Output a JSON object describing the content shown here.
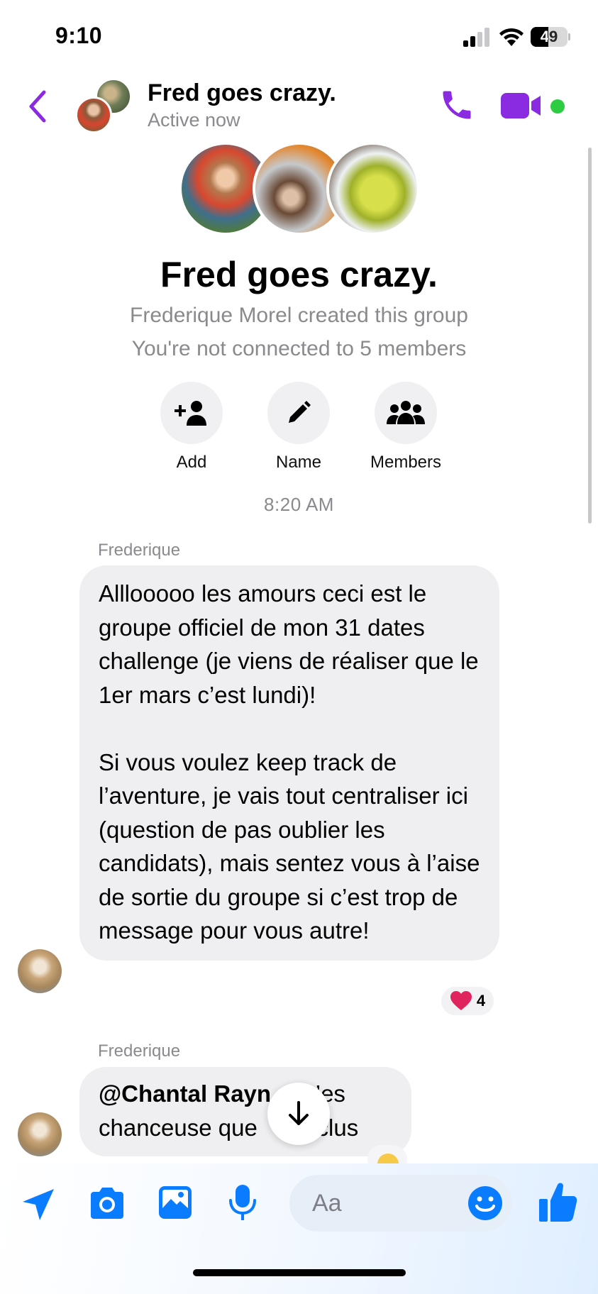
{
  "status_bar": {
    "time": "9:10",
    "battery": "49",
    "battery_level": 0.49
  },
  "header": {
    "title": "Fred goes crazy.",
    "subtitle": "Active now"
  },
  "group_intro": {
    "name": "Fred goes crazy.",
    "creator_line": "Frederique Morel created this group",
    "connection_line": "You're not connected to 5 members",
    "actions": [
      {
        "label": "Add",
        "icon": "add-person-icon"
      },
      {
        "label": "Name",
        "icon": "pencil-icon"
      },
      {
        "label": "Members",
        "icon": "group-icon"
      }
    ]
  },
  "timestamp": "8:20 AM",
  "messages": [
    {
      "sender": "Frederique",
      "text": "Alllooooo les amours ceci est le groupe officiel de mon 31 dates challenge (je viens de réaliser que le 1er mars c’est lundi)!\n\nSi vous voulez keep track de l’aventure, je vais tout centraliser ici (question de pas oublier les candidats), mais sentez vous à l’aise de sortie du groupe si c’est trop de message pour vous autre!",
      "reaction": {
        "emoji": "❤️",
        "count": "4"
      }
    },
    {
      "sender": "Frederique",
      "mention": "@Chantal Rayn",
      "text_line1_end": "d t’es",
      "text_line2_start": "chanceuse que",
      "text_line2_end": "inclus"
    }
  ],
  "composer": {
    "placeholder": "Aa",
    "icons": [
      "location-arrow-icon",
      "camera-icon",
      "gallery-icon",
      "microphone-icon",
      "emoji-icon",
      "thumbs-up-icon"
    ]
  },
  "colors": {
    "accent_purple": "#8a2be2",
    "accent_blue": "#0a7cff",
    "online_green": "#2ecc40",
    "bubble_gray": "#efeff1",
    "heart_red": "#e0245e"
  }
}
